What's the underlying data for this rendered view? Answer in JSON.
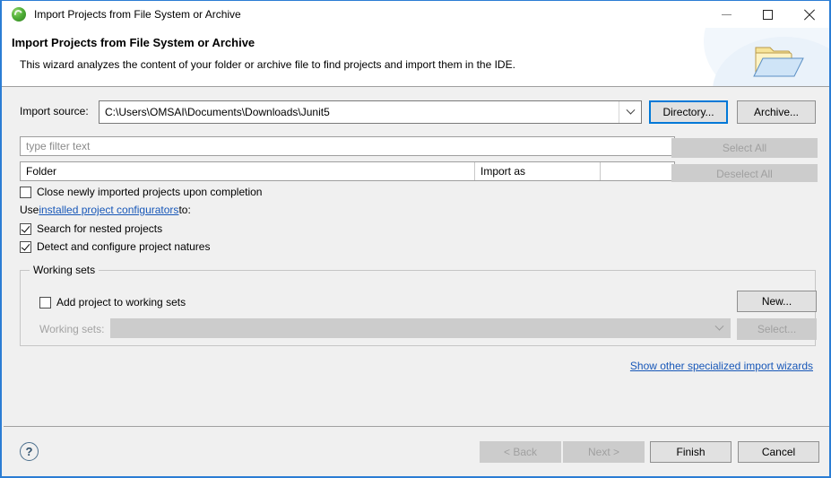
{
  "window": {
    "title": "Import Projects from File System or Archive",
    "icon": "eclipse-green-icon",
    "controls": {
      "minimize": "minimize-icon",
      "maximize": "maximize-icon",
      "close": "close-icon"
    }
  },
  "banner": {
    "title": "Import Projects from File System or Archive",
    "subtitle": "This wizard analyzes the content of your folder or archive file to find projects and import them in the IDE.",
    "icon": "folder-open-icon"
  },
  "source": {
    "label": "Import source:",
    "value": "C:\\Users\\OMSAI\\Documents\\Downloads\\Junit5",
    "directory_button": "Directory...",
    "archive_button": "Archive..."
  },
  "filter": {
    "placeholder": "type filter text",
    "value": ""
  },
  "table": {
    "columns": [
      "Folder",
      "Import as",
      ""
    ],
    "rows": []
  },
  "list_buttons": {
    "select_all": "Select All",
    "deselect_all": "Deselect All"
  },
  "options": {
    "close_imported": {
      "label": "Close newly imported projects upon completion",
      "checked": false
    },
    "use_line": {
      "prefix": "Use ",
      "link": "installed project configurators",
      "suffix": " to:"
    },
    "search_nested": {
      "label": "Search for nested projects",
      "checked": true
    },
    "detect_natures": {
      "label": "Detect and configure project natures",
      "checked": true
    }
  },
  "working_sets": {
    "group_title": "Working sets",
    "add_checkbox": {
      "label": "Add project to working sets",
      "checked": false
    },
    "combo_label": "Working sets:",
    "combo_value": "",
    "new_button": "New...",
    "select_button": "Select..."
  },
  "specialized_link": "Show other specialized import wizards",
  "footer": {
    "help": "?",
    "back": "< Back",
    "next": "Next >",
    "finish": "Finish",
    "cancel": "Cancel"
  },
  "colors": {
    "accent": "#0078d7",
    "window_border": "#2b7dd4",
    "dialog_bg": "#f0f0f0",
    "link": "#1757b8",
    "disabled_text": "#a0a0a0"
  }
}
